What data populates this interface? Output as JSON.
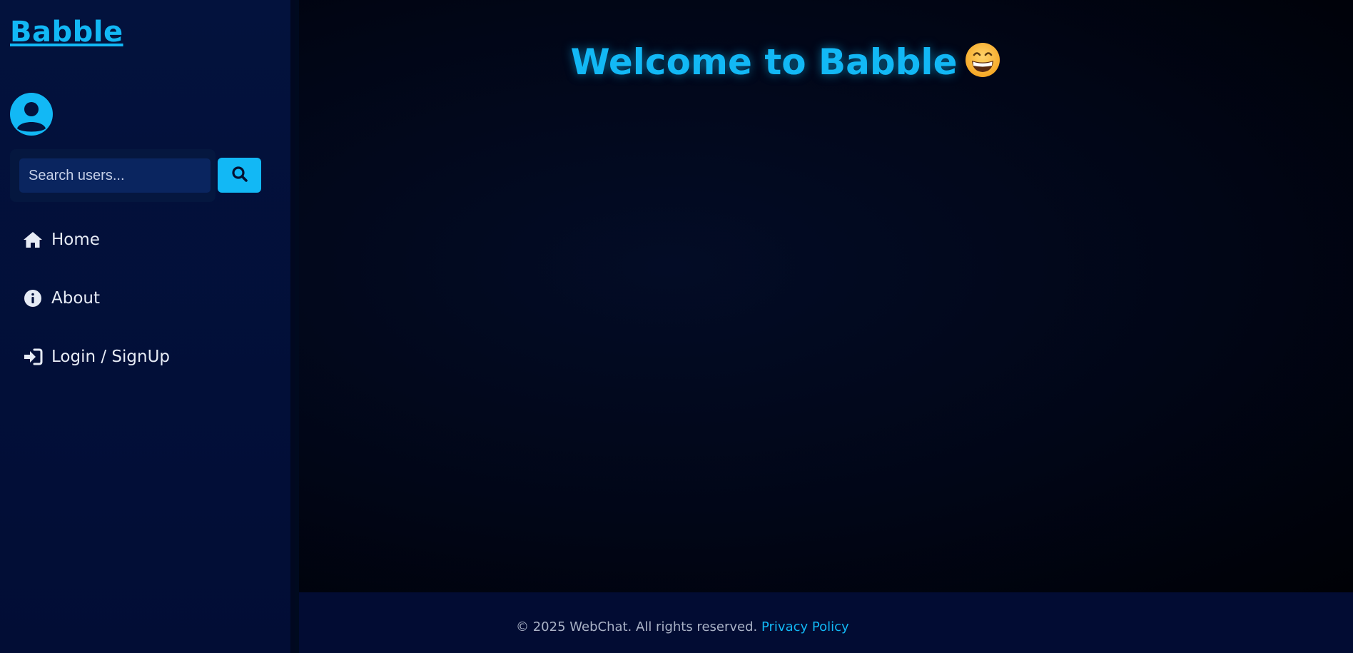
{
  "app": {
    "logo": "Babble"
  },
  "sidebar": {
    "search": {
      "placeholder": "Search users..."
    },
    "nav": [
      {
        "label": "Home",
        "icon": "home-icon"
      },
      {
        "label": "About",
        "icon": "info-icon"
      },
      {
        "label": "Login / SignUp",
        "icon": "sign-in-icon"
      }
    ]
  },
  "main": {
    "welcome": "Welcome to Babble",
    "emoji": "grinning-face-icon"
  },
  "footer": {
    "copyright": "© 2025 WebChat. All rights reserved.",
    "privacy_link": "Privacy Policy"
  },
  "colors": {
    "accent": "#12b8f5",
    "sidebar_bg": "#03123d",
    "main_bg": "#010617",
    "footer_bg": "#020c33"
  }
}
